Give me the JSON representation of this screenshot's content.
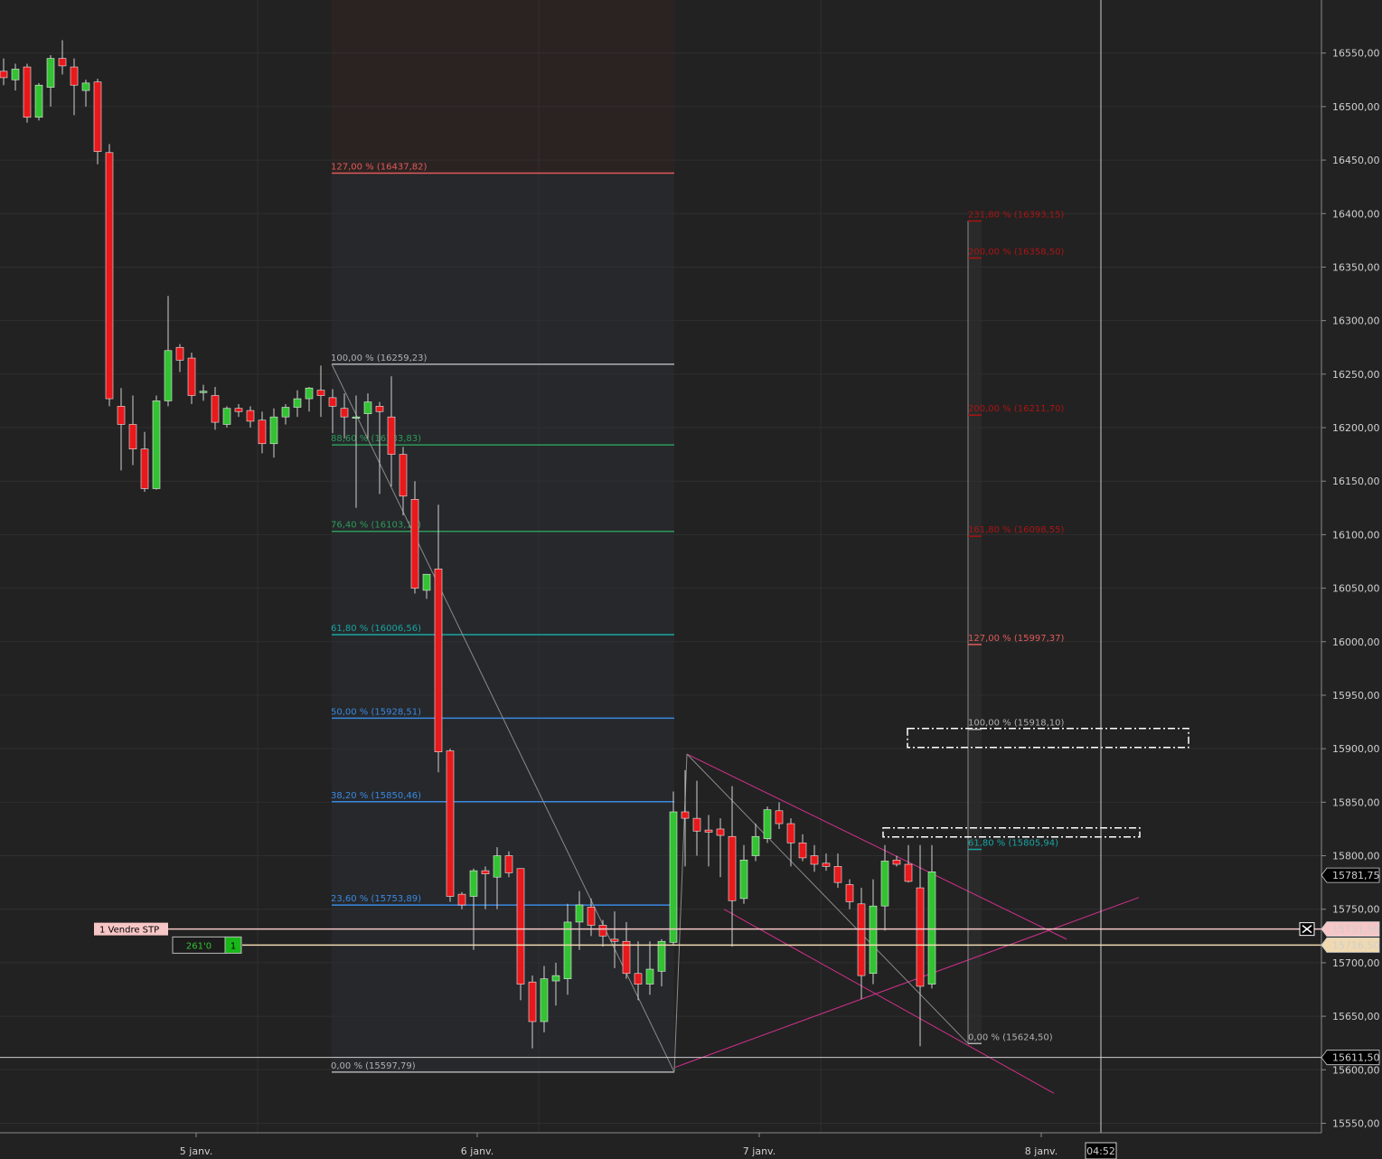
{
  "chart_data": {
    "type": "candlestick",
    "title": "",
    "xlabel": "",
    "ylabel": "",
    "ylim": [
      15540,
      16600
    ],
    "y_ticks": [
      "16550,00",
      "16500,00",
      "16450,00",
      "16400,00",
      "16350,00",
      "16300,00",
      "16250,00",
      "16200,00",
      "16150,00",
      "16100,00",
      "16050,00",
      "16000,00",
      "15950,00",
      "15900,00",
      "15850,00",
      "15800,00",
      "15750,00",
      "15700,00",
      "15650,00",
      "15600,00",
      "15550,00"
    ],
    "y_tick_values": [
      16550,
      16500,
      16450,
      16400,
      16350,
      16300,
      16250,
      16200,
      16150,
      16100,
      16050,
      16000,
      15950,
      15900,
      15850,
      15800,
      15750,
      15700,
      15650,
      15600,
      15550
    ],
    "x_ticks": [
      "5 janv.",
      "6 janv.",
      "7 janv.",
      "8 janv."
    ],
    "time_cursor": "04:52",
    "candles": [
      {
        "o": 16533,
        "h": 16545,
        "l": 16520,
        "c": 16527
      },
      {
        "o": 16525,
        "h": 16540,
        "l": 16515,
        "c": 16535
      },
      {
        "o": 16537,
        "h": 16540,
        "l": 16485,
        "c": 16490
      },
      {
        "o": 16490,
        "h": 16522,
        "l": 16487,
        "c": 16520
      },
      {
        "o": 16518,
        "h": 16548,
        "l": 16500,
        "c": 16545
      },
      {
        "o": 16545,
        "h": 16562,
        "l": 16530,
        "c": 16538
      },
      {
        "o": 16537,
        "h": 16545,
        "l": 16492,
        "c": 16520
      },
      {
        "o": 16515,
        "h": 16525,
        "l": 16500,
        "c": 16522
      },
      {
        "o": 16523,
        "h": 16526,
        "l": 16446,
        "c": 16458
      },
      {
        "o": 16457,
        "h": 16465,
        "l": 16220,
        "c": 16227
      },
      {
        "o": 16220,
        "h": 16237,
        "l": 16160,
        "c": 16203
      },
      {
        "o": 16203,
        "h": 16230,
        "l": 16165,
        "c": 16180
      },
      {
        "o": 16180,
        "h": 16196,
        "l": 16140,
        "c": 16143
      },
      {
        "o": 16143,
        "h": 16230,
        "l": 16142,
        "c": 16225
      },
      {
        "o": 16225,
        "h": 16323,
        "l": 16220,
        "c": 16272
      },
      {
        "o": 16275,
        "h": 16278,
        "l": 16252,
        "c": 16263
      },
      {
        "o": 16265,
        "h": 16270,
        "l": 16222,
        "c": 16230
      },
      {
        "o": 16234,
        "h": 16240,
        "l": 16225,
        "c": 16234
      },
      {
        "o": 16230,
        "h": 16238,
        "l": 16198,
        "c": 16205
      },
      {
        "o": 16203,
        "h": 16220,
        "l": 16200,
        "c": 16218
      },
      {
        "o": 16218,
        "h": 16222,
        "l": 16210,
        "c": 16215
      },
      {
        "o": 16216,
        "h": 16220,
        "l": 16200,
        "c": 16206
      },
      {
        "o": 16207,
        "h": 16215,
        "l": 16176,
        "c": 16185
      },
      {
        "o": 16185,
        "h": 16218,
        "l": 16172,
        "c": 16210
      },
      {
        "o": 16210,
        "h": 16222,
        "l": 16203,
        "c": 16219
      },
      {
        "o": 16219,
        "h": 16235,
        "l": 16210,
        "c": 16227
      },
      {
        "o": 16227,
        "h": 16238,
        "l": 16215,
        "c": 16237
      },
      {
        "o": 16235,
        "h": 16258,
        "l": 16210,
        "c": 16230
      },
      {
        "o": 16228,
        "h": 16236,
        "l": 16195,
        "c": 16220
      },
      {
        "o": 16218,
        "h": 16232,
        "l": 16190,
        "c": 16210
      },
      {
        "o": 16210,
        "h": 16230,
        "l": 16125,
        "c": 16210
      },
      {
        "o": 16213,
        "h": 16232,
        "l": 16190,
        "c": 16224
      },
      {
        "o": 16220,
        "h": 16224,
        "l": 16138,
        "c": 16215
      },
      {
        "o": 16210,
        "h": 16248,
        "l": 16145,
        "c": 16175
      },
      {
        "o": 16175,
        "h": 16182,
        "l": 16118,
        "c": 16136
      },
      {
        "o": 16133,
        "h": 16150,
        "l": 16045,
        "c": 16050
      },
      {
        "o": 16048,
        "h": 16060,
        "l": 16040,
        "c": 16063
      },
      {
        "o": 16068,
        "h": 16128,
        "l": 15878,
        "c": 15897
      },
      {
        "o": 15898,
        "h": 15900,
        "l": 15757,
        "c": 15762
      },
      {
        "o": 15764,
        "h": 15766,
        "l": 15750,
        "c": 15754
      },
      {
        "o": 15762,
        "h": 15788,
        "l": 15712,
        "c": 15786
      },
      {
        "o": 15786,
        "h": 15790,
        "l": 15750,
        "c": 15783
      },
      {
        "o": 15780,
        "h": 15808,
        "l": 15750,
        "c": 15800
      },
      {
        "o": 15800,
        "h": 15804,
        "l": 15780,
        "c": 15784
      },
      {
        "o": 15788,
        "h": 15788,
        "l": 15665,
        "c": 15680
      },
      {
        "o": 15682,
        "h": 15688,
        "l": 15620,
        "c": 15645
      },
      {
        "o": 15645,
        "h": 15697,
        "l": 15635,
        "c": 15685
      },
      {
        "o": 15683,
        "h": 15700,
        "l": 15660,
        "c": 15688
      },
      {
        "o": 15685,
        "h": 15755,
        "l": 15670,
        "c": 15738
      },
      {
        "o": 15738,
        "h": 15767,
        "l": 15712,
        "c": 15754
      },
      {
        "o": 15752,
        "h": 15760,
        "l": 15725,
        "c": 15735
      },
      {
        "o": 15735,
        "h": 15740,
        "l": 15715,
        "c": 15725
      },
      {
        "o": 15722,
        "h": 15748,
        "l": 15695,
        "c": 15720
      },
      {
        "o": 15720,
        "h": 15738,
        "l": 15685,
        "c": 15690
      },
      {
        "o": 15690,
        "h": 15720,
        "l": 15665,
        "c": 15680
      },
      {
        "o": 15680,
        "h": 15720,
        "l": 15670,
        "c": 15694
      },
      {
        "o": 15692,
        "h": 15722,
        "l": 15678,
        "c": 15720
      },
      {
        "o": 15719,
        "h": 15860,
        "l": 15716,
        "c": 15841
      },
      {
        "o": 15841,
        "h": 15880,
        "l": 15790,
        "c": 15835
      },
      {
        "o": 15835,
        "h": 15870,
        "l": 15800,
        "c": 15823
      },
      {
        "o": 15824,
        "h": 15838,
        "l": 15790,
        "c": 15822
      },
      {
        "o": 15825,
        "h": 15835,
        "l": 15780,
        "c": 15819
      },
      {
        "o": 15818,
        "h": 15865,
        "l": 15715,
        "c": 15758
      },
      {
        "o": 15760,
        "h": 15810,
        "l": 15755,
        "c": 15796
      },
      {
        "o": 15800,
        "h": 15830,
        "l": 15795,
        "c": 15818
      },
      {
        "o": 15816,
        "h": 15846,
        "l": 15812,
        "c": 15843
      },
      {
        "o": 15842,
        "h": 15850,
        "l": 15825,
        "c": 15830
      },
      {
        "o": 15830,
        "h": 15835,
        "l": 15790,
        "c": 15812
      },
      {
        "o": 15812,
        "h": 15820,
        "l": 15795,
        "c": 15798
      },
      {
        "o": 15800,
        "h": 15810,
        "l": 15785,
        "c": 15792
      },
      {
        "o": 15793,
        "h": 15802,
        "l": 15786,
        "c": 15790
      },
      {
        "o": 15790,
        "h": 15802,
        "l": 15770,
        "c": 15775
      },
      {
        "o": 15773,
        "h": 15778,
        "l": 15750,
        "c": 15757
      },
      {
        "o": 15755,
        "h": 15770,
        "l": 15666,
        "c": 15688
      },
      {
        "o": 15690,
        "h": 15778,
        "l": 15680,
        "c": 15753
      },
      {
        "o": 15753,
        "h": 15810,
        "l": 15730,
        "c": 15795
      },
      {
        "o": 15796,
        "h": 15800,
        "l": 15790,
        "c": 15792
      },
      {
        "o": 15792,
        "h": 15810,
        "l": 15775,
        "c": 15776
      },
      {
        "o": 15770,
        "h": 15810,
        "l": 15622,
        "c": 15678
      },
      {
        "o": 15680,
        "h": 15810,
        "l": 15676,
        "c": 15785
      }
    ],
    "fib_retracement": [
      {
        "label": "127,00 % (16437,82)",
        "value": 16437.82,
        "color": "#e05a5a"
      },
      {
        "label": "100,00 % (16259,23)",
        "value": 16259.23,
        "color": "#b0b0b0"
      },
      {
        "label": "88,60 % (16183,83)",
        "value": 16183.83,
        "color": "#2e9a5a"
      },
      {
        "label": "76,40 % (16103,13)",
        "value": 16103.13,
        "color": "#2e9a5a"
      },
      {
        "label": "61,80 % (16006,56)",
        "value": 16006.56,
        "color": "#1aa3a3"
      },
      {
        "label": "50,00 % (15928,51)",
        "value": 15928.51,
        "color": "#3a88e0"
      },
      {
        "label": "38,20 % (15850,46)",
        "value": 15850.46,
        "color": "#3a88e0"
      },
      {
        "label": "23,60 % (15753,89)",
        "value": 15753.89,
        "color": "#3a88e0"
      },
      {
        "label": "0,00 % (15597,79)",
        "value": 15597.79,
        "color": "#b0b0b0"
      }
    ],
    "fib_extension": [
      {
        "label": "231,80 % (16393,15)",
        "value": 16393.15,
        "color": "#aa1414"
      },
      {
        "label": "200,00 % (16358,50)",
        "value": 16358.5,
        "color": "#aa1414"
      },
      {
        "label": "200,00 % (16211,70)",
        "value": 16211.7,
        "color": "#aa1414"
      },
      {
        "label": "161,80 % (16098,55)",
        "value": 16098.55,
        "color": "#aa1414"
      },
      {
        "label": "127,00 % (15997,37)",
        "value": 15997.37,
        "color": "#e05a5a"
      },
      {
        "label": "100,00 % (15918,10)",
        "value": 15918.1,
        "color": "#b0b0b0"
      },
      {
        "label": "61,80 % (15805,94)",
        "value": 15805.94,
        "color": "#1aa3a3"
      },
      {
        "label": "0,00 % (15624,50)",
        "value": 15624.5,
        "color": "#b0b0b0"
      }
    ],
    "price_labels": [
      {
        "text": "15781,75",
        "value": 15781.75,
        "bg": "#000000",
        "fg": "#ffffff"
      },
      {
        "text": "15731,50",
        "value": 15731.5,
        "bg": "#f7c6c6",
        "fg": "#000000"
      },
      {
        "text": "15716,50",
        "value": 15716.5,
        "bg": "#f0d9b0",
        "fg": "#000000"
      },
      {
        "text": "15611,50",
        "value": 15611.5,
        "bg": "#000000",
        "fg": "#ffffff"
      }
    ],
    "order_sell_label": "1  Vendre STP",
    "order_sell_value": 15731.5,
    "position_pnl": "261'0",
    "position_qty": "1",
    "position_value": 15716.5,
    "last_price_value": 15611.5,
    "close_icon": "close-x-icon",
    "colors": {
      "up": "#33c233",
      "down": "#e8191c",
      "trend": "#d0308c",
      "background": "#222222"
    }
  }
}
